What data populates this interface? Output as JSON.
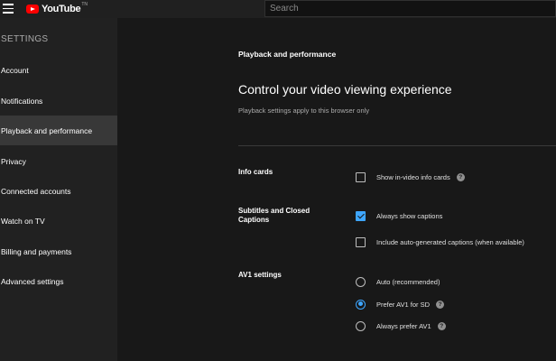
{
  "header": {
    "logo_text": "YouTube",
    "logo_country": "TN",
    "search_placeholder": "Search"
  },
  "sidebar": {
    "heading": "SETTINGS",
    "items": [
      {
        "label": "Account"
      },
      {
        "label": "Notifications"
      },
      {
        "label": "Playback and performance",
        "active": true
      },
      {
        "label": "Privacy"
      },
      {
        "label": "Connected accounts"
      },
      {
        "label": "Watch on TV"
      },
      {
        "label": "Billing and payments"
      },
      {
        "label": "Advanced settings"
      }
    ]
  },
  "main": {
    "section_title": "Playback and performance",
    "heading": "Control your video viewing experience",
    "subheading": "Playback settings apply to this browser only",
    "info_cards": {
      "label": "Info cards",
      "option": {
        "label": "Show in-video info cards",
        "checked": false
      }
    },
    "subtitles": {
      "label": "Subtitles and Closed Captions",
      "options": [
        {
          "label": "Always show captions",
          "checked": true
        },
        {
          "label": "Include auto-generated captions (when available)",
          "checked": false
        }
      ]
    },
    "av1": {
      "label": "AV1 settings",
      "options": [
        {
          "label": "Auto (recommended)",
          "selected": false
        },
        {
          "label": "Prefer AV1 for SD",
          "selected": true
        },
        {
          "label": "Always prefer AV1",
          "selected": false
        }
      ]
    },
    "help_glyph": "?"
  },
  "colors": {
    "accent": "#3ea6ff",
    "brand": "#ff0000",
    "background": "#181818",
    "sidebar": "#212121",
    "sidebar_active": "#383838"
  }
}
